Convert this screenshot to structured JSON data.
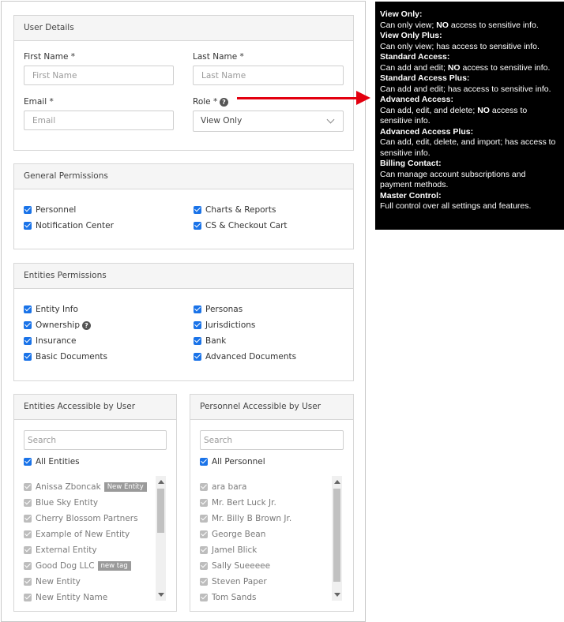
{
  "user_details": {
    "title": "User Details",
    "first_name_label": "First Name *",
    "first_name_placeholder": "First Name",
    "last_name_label": "Last Name *",
    "last_name_placeholder": "Last Name",
    "email_label": "Email *",
    "email_placeholder": "Email",
    "role_label": "Role *",
    "role_value": "View Only"
  },
  "general_permissions": {
    "title": "General Permissions",
    "items": [
      {
        "label": "Personnel",
        "checked": true
      },
      {
        "label": "Notification Center",
        "checked": true
      },
      {
        "label": "Charts & Reports",
        "checked": true
      },
      {
        "label": "CS & Checkout Cart",
        "checked": true
      }
    ]
  },
  "entities_permissions": {
    "title": "Entities Permissions",
    "items": [
      {
        "label": "Entity Info",
        "checked": true
      },
      {
        "label": "Ownership",
        "checked": true
      },
      {
        "label": "Insurance",
        "checked": true
      },
      {
        "label": "Basic Documents",
        "checked": true
      },
      {
        "label": "Personas",
        "checked": true
      },
      {
        "label": "Jurisdictions",
        "checked": true
      },
      {
        "label": "Bank",
        "checked": true
      },
      {
        "label": "Advanced Documents",
        "checked": true
      }
    ]
  },
  "entities_accessible": {
    "title": "Entities Accessible by User",
    "search_placeholder": "Search",
    "all_label": "All Entities",
    "items": [
      {
        "label": "Anissa Zboncak",
        "tag": "New Entity"
      },
      {
        "label": "Blue Sky Entity"
      },
      {
        "label": "Cherry Blossom Partners"
      },
      {
        "label": "Example of New Entity"
      },
      {
        "label": "External Entity"
      },
      {
        "label": "Good Dog LLC",
        "tag": "new tag"
      },
      {
        "label": "New Entity"
      },
      {
        "label": "New Entity Name"
      }
    ]
  },
  "personnel_accessible": {
    "title": "Personnel Accessible by User",
    "search_placeholder": "Search",
    "all_label": "All Personnel",
    "items": [
      {
        "label": "ara bara"
      },
      {
        "label": "Mr. Bert Luck Jr."
      },
      {
        "label": "Mr. Billy B Brown Jr."
      },
      {
        "label": "George Bean"
      },
      {
        "label": "Jamel Blick"
      },
      {
        "label": "Sally Sueeeee"
      },
      {
        "label": "Steven Paper"
      },
      {
        "label": "Tom Sands"
      }
    ]
  },
  "role_tooltip": {
    "entries": [
      {
        "title": "View Only:",
        "desc_pre": "Can only view; ",
        "desc_bold": "NO",
        "desc_post": " access to sensitive info."
      },
      {
        "title": "View Only Plus:",
        "desc_pre": "Can only view; has access to sensitive info.",
        "desc_bold": "",
        "desc_post": ""
      },
      {
        "title": "Standard Access:",
        "desc_pre": "Can add and edit; ",
        "desc_bold": "NO",
        "desc_post": " access to sensitive info."
      },
      {
        "title": "Standard Access Plus:",
        "desc_pre": "Can add and edit; has access to sensitive info.",
        "desc_bold": "",
        "desc_post": ""
      },
      {
        "title": "Advanced Access:",
        "desc_pre": "Can add, edit, and delete; ",
        "desc_bold": "NO",
        "desc_post": " access to sensitive info."
      },
      {
        "title": "Advanced Access Plus:",
        "desc_pre": "Can add, edit, delete, and import; has access to sensitive info.",
        "desc_bold": "",
        "desc_post": ""
      },
      {
        "title": "Billing Contact:",
        "desc_pre": "Can manage account subscriptions and payment methods.",
        "desc_bold": "",
        "desc_post": ""
      },
      {
        "title": "Master Control:",
        "desc_pre": "Full control over all settings and features.",
        "desc_bold": "",
        "desc_post": ""
      }
    ]
  },
  "colors": {
    "checkbox": "#1a73e8",
    "checkbox_disabled": "#bdbdbd",
    "arrow": "#e3000f",
    "tooltip_bg": "#000000"
  }
}
